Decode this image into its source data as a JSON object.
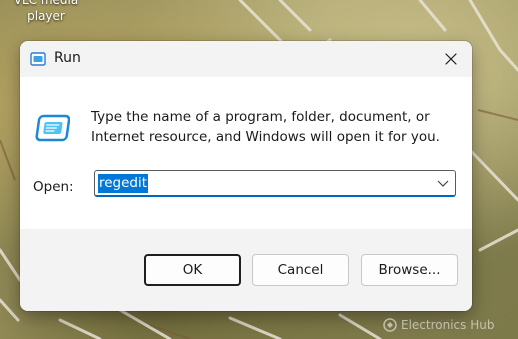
{
  "desktop": {
    "icon_label": "VLC media player"
  },
  "dialog": {
    "title": "Run",
    "description": "Type the name of a program, folder, document, or Internet resource, and Windows will open it for you.",
    "open_label": "Open:",
    "open_value": "regedit",
    "buttons": {
      "ok": "OK",
      "cancel": "Cancel",
      "browse": "Browse..."
    },
    "icons": {
      "title": "run-app-icon",
      "close": "close-icon",
      "main": "run-app-icon",
      "dropdown": "chevron-down-icon"
    },
    "accent_color": "#0078d7"
  },
  "watermark": {
    "text": "Electronics Hub"
  }
}
